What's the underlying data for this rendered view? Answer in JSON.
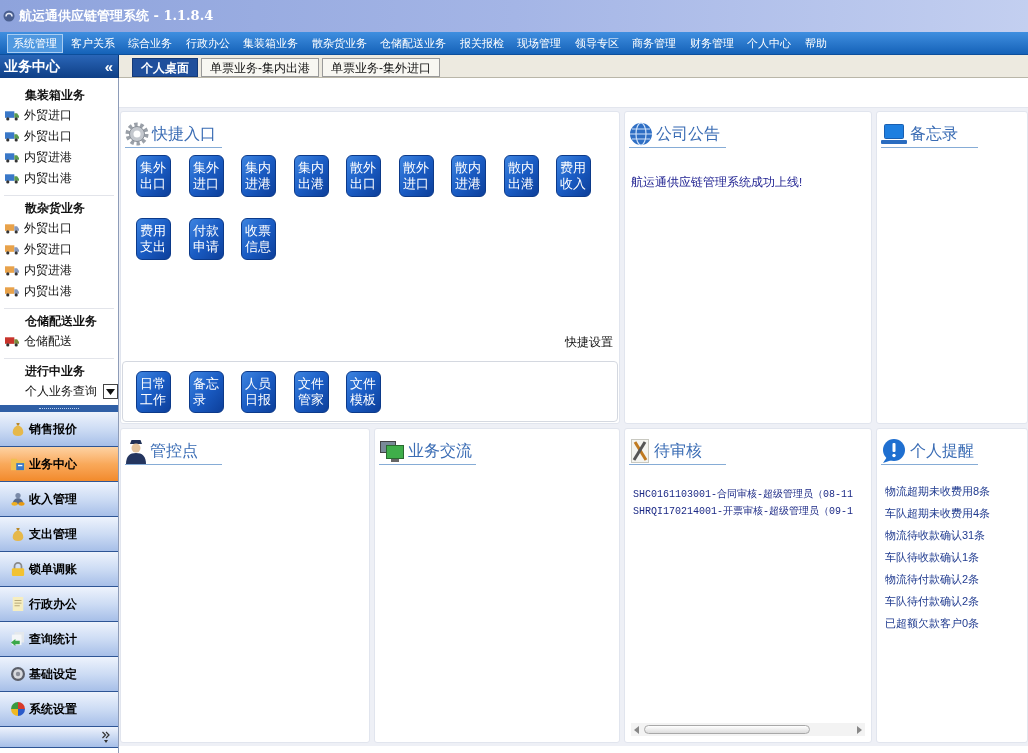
{
  "window": {
    "title": "航运通供应链管理系统 - 1.1.8.4"
  },
  "menu_bar": [
    {
      "label": "系统管理",
      "selected": true
    },
    {
      "label": "客户关系",
      "selected": false
    },
    {
      "label": "综合业务",
      "selected": false
    },
    {
      "label": "行政办公",
      "selected": false
    },
    {
      "label": "集装箱业务",
      "selected": false
    },
    {
      "label": "散杂货业务",
      "selected": false
    },
    {
      "label": "仓储配送业务",
      "selected": false
    },
    {
      "label": "报关报检",
      "selected": false
    },
    {
      "label": "现场管理",
      "selected": false
    },
    {
      "label": "领导专区",
      "selected": false
    },
    {
      "label": "商务管理",
      "selected": false
    },
    {
      "label": "财务管理",
      "selected": false
    },
    {
      "label": "个人中心",
      "selected": false
    },
    {
      "label": "帮助",
      "selected": false
    }
  ],
  "sidebar": {
    "title": "业务中心",
    "collapse": "«",
    "sections": [
      {
        "heading": "集装箱业务",
        "kind": "container",
        "items": [
          "外贸进口",
          "外贸出口",
          "内贸进港",
          "内贸出港"
        ]
      },
      {
        "heading": "散杂货业务",
        "kind": "bulk",
        "items": [
          "外贸出口",
          "外贸进口",
          "内贸进港",
          "内贸出港"
        ]
      },
      {
        "heading": "仓储配送业务",
        "kind": "warehouse",
        "items": [
          "仓储配送"
        ]
      },
      {
        "heading": "进行中业务",
        "kind": "query",
        "items": [
          "个人业务查询"
        ]
      }
    ],
    "nav_panels": [
      {
        "label": "销售报价",
        "kind": "moneybag",
        "selected": false
      },
      {
        "label": "业务中心",
        "kind": "folder",
        "selected": true
      },
      {
        "label": "收入管理",
        "kind": "income",
        "selected": false
      },
      {
        "label": "支出管理",
        "kind": "moneybag",
        "selected": false
      },
      {
        "label": "锁单调账",
        "kind": "lock",
        "selected": false
      },
      {
        "label": "行政办公",
        "kind": "document",
        "selected": false
      },
      {
        "label": "查询统计",
        "kind": "papers",
        "selected": false
      },
      {
        "label": "基础设定",
        "kind": "badge",
        "selected": false
      },
      {
        "label": "系统设置",
        "kind": "ball",
        "selected": false
      }
    ]
  },
  "tabs": [
    {
      "label": "个人桌面",
      "selected": true
    },
    {
      "label": "单票业务-集内出港",
      "selected": false
    },
    {
      "label": "单票业务-集外进口",
      "selected": false
    }
  ],
  "dashboard": {
    "quick_entry": {
      "title": "快捷入口",
      "shortcuts": [
        "集外出口",
        "集外进口",
        "集内进港",
        "集内出港",
        "散外出口",
        "散外进口",
        "散内进港",
        "散内出港",
        "费用收入",
        "费用支出",
        "付款申请",
        "收票信息"
      ],
      "settings_link": "快捷设置",
      "pinned": [
        "日常工作",
        "备忘录",
        "人员日报",
        "文件管家",
        "文件模板"
      ]
    },
    "announcements": {
      "title": "公司公告",
      "items": [
        "航运通供应链管理系统成功上线!"
      ]
    },
    "memo": {
      "title": "备忘录"
    },
    "control_points": {
      "title": "管控点"
    },
    "business_exchange": {
      "title": "业务交流"
    },
    "pending_review": {
      "title": "待审核",
      "items": [
        "SHC0161103001-合同审核-超级管理员（08-11",
        "SHRQI170214001-开票审核-超级管理员（09-1"
      ]
    },
    "reminders": {
      "title": "个人提醒",
      "items": [
        "物流超期未收费用8条",
        "车队超期未收费用4条",
        "物流待收款确认31条",
        "车队待收款确认1条",
        "物流待付款确认2条",
        "车队待付款确认2条",
        "已超额欠款客户0条"
      ]
    }
  }
}
